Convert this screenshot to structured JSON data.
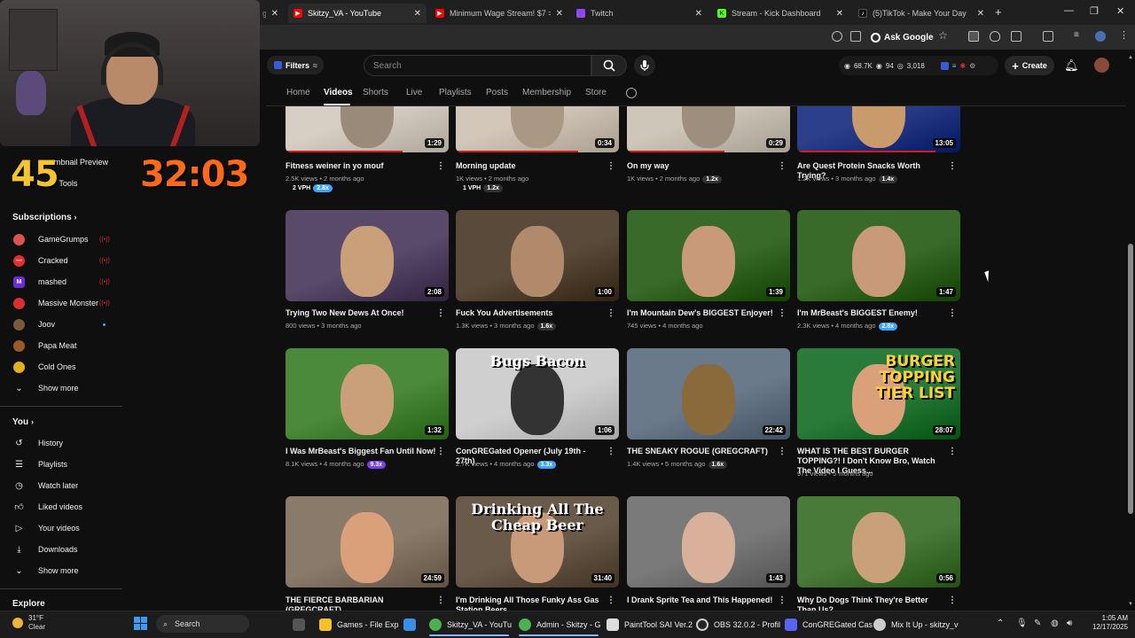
{
  "browser": {
    "tabs": [
      {
        "title": "Skitzy_VA - YouTube",
        "color": "#ff0000"
      },
      {
        "title": "Minimum Wage Stream! $7 = ...",
        "color": "#ff0000"
      },
      {
        "title": "Twitch",
        "color": "#9146ff"
      },
      {
        "title": "Stream - Kick Dashboard",
        "color": "#53fc18"
      },
      {
        "title": "(5)TikTok - Make Your Day",
        "color": "#000000"
      }
    ],
    "ask_google": "Ask Google"
  },
  "overlay": {
    "left_number": "45",
    "right_timer": "32:03",
    "partial_items": [
      "umbnail Preview",
      "re Tools"
    ]
  },
  "sidebar": {
    "subscriptions_title": "Subscriptions",
    "subscriptions": [
      {
        "label": "GameGrumps",
        "color": "#d9534f"
      },
      {
        "label": "Cracked",
        "color": "#e23030"
      },
      {
        "label": "mashed",
        "color": "#6a2cd6"
      },
      {
        "label": "Massive Monster",
        "color": "#d93030"
      },
      {
        "label": "Joov",
        "color": "#7a5a3a"
      },
      {
        "label": "Papa Meat",
        "color": "#9a5a2a"
      },
      {
        "label": "Cold Ones",
        "color": "#e0b020"
      }
    ],
    "show_more": "Show more",
    "you_title": "You",
    "you_items": [
      "History",
      "Playlists",
      "Watch later",
      "Liked videos",
      "Your videos",
      "Downloads"
    ],
    "show_more_2": "Show more",
    "explore_title": "Explore"
  },
  "header": {
    "filters_label": "Filters",
    "search_placeholder": "Search",
    "stats": {
      "views": "68.7K",
      "count1": "94",
      "count2": "3,018"
    },
    "create_label": "Create"
  },
  "channel_tabs": [
    "Home",
    "Videos",
    "Shorts",
    "Live",
    "Playlists",
    "Posts",
    "Membership",
    "Store"
  ],
  "videos": [
    {
      "title": "Fitness weiner in yo mouf",
      "meta": "2.5K views • 2 months ago",
      "duration": "1:29",
      "vph": "2 VPH",
      "badge": "2.8x",
      "badge_color": "#3ea6ff"
    },
    {
      "title": "Morning update",
      "meta": "1K views • 2 months ago",
      "duration": "0:34",
      "vph": "1 VPH",
      "badge": "1.2x",
      "badge_color": "#333333"
    },
    {
      "title": "On my way",
      "meta": "1K views • 2 months ago",
      "duration": "0:29",
      "badge": "1.2x",
      "badge_color": "#333333"
    },
    {
      "title": "Are Quest Protein Snacks Worth Trying?",
      "meta": "1.2K views • 3 months ago",
      "duration": "13:05",
      "badge": "1.4x",
      "badge_color": "#333333"
    },
    {
      "title": "Trying Two New Dews At Once!",
      "meta": "800 views • 3 months ago",
      "duration": "2:08"
    },
    {
      "title": "Fuck You Advertisements",
      "meta": "1.3K views • 3 months ago",
      "duration": "1:00",
      "badge": "1.6x",
      "badge_color": "#333333"
    },
    {
      "title": "I'm Mountain Dew's BIGGEST Enjoyer!",
      "meta": "745 views • 4 months ago",
      "duration": "1:39"
    },
    {
      "title": "I'm MrBeast's BIGGEST Enemy!",
      "meta": "2.3K views • 4 months ago",
      "duration": "1:47",
      "badge": "2.8x",
      "badge_color": "#3ea6ff"
    },
    {
      "title": "I Was MrBeast's Biggest Fan Until Now!",
      "meta": "8.1K views • 4 months ago",
      "duration": "1:32",
      "badge": "9.3x",
      "badge_color": "#7b3ff2"
    },
    {
      "title": "ConGREGated Opener (July 19th - 27th)",
      "meta": "2.7K views • 4 months ago",
      "duration": "1:06",
      "badge": "3.3x",
      "badge_color": "#3ea6ff",
      "thumb_text": "Bugs Bacon"
    },
    {
      "title": "THE SNEAKY ROGUE (GREGCRAFT)",
      "meta": "1.4K views • 5 months ago",
      "duration": "22:42",
      "badge": "1.6x",
      "badge_color": "#333333"
    },
    {
      "title": "WHAT IS THE BEST BURGER TOPPING?! I Don't Know Bro, Watch The Video I Guess...",
      "meta": "971 views • 5 months ago",
      "duration": "28:07",
      "thumb_text": "BURGER TOPPING TIER LIST"
    },
    {
      "title": "THE FIERCE BARBARIAN (GREGCRAFT)",
      "meta": "",
      "duration": "24:59"
    },
    {
      "title": "I'm Drinking All Those Funky Ass Gas Station Beers",
      "meta": "",
      "duration": "31:40",
      "thumb_text": "Drinking All The Cheap Beer"
    },
    {
      "title": "I Drank Sprite Tea and This Happened!",
      "meta": "",
      "duration": "1:43"
    },
    {
      "title": "Why Do Dogs Think They're Better Than Us?",
      "meta": "",
      "duration": "0:56"
    }
  ],
  "taskbar": {
    "weather_temp": "31°F",
    "weather_desc": "Clear",
    "search_label": "Search",
    "apps": [
      {
        "label": "Games - File Exp"
      },
      {
        "label": "Skitzy_VA - YouTu"
      },
      {
        "label": "Admin - Skitzy - G"
      },
      {
        "label": "PaintTool SAI Ver.2"
      },
      {
        "label": "OBS 32.0.2 - Profil"
      },
      {
        "label": "ConGREGated Cas"
      },
      {
        "label": "Mix It Up - skitzy_v"
      }
    ],
    "time": "1:05 AM",
    "date": "12/17/2025"
  }
}
